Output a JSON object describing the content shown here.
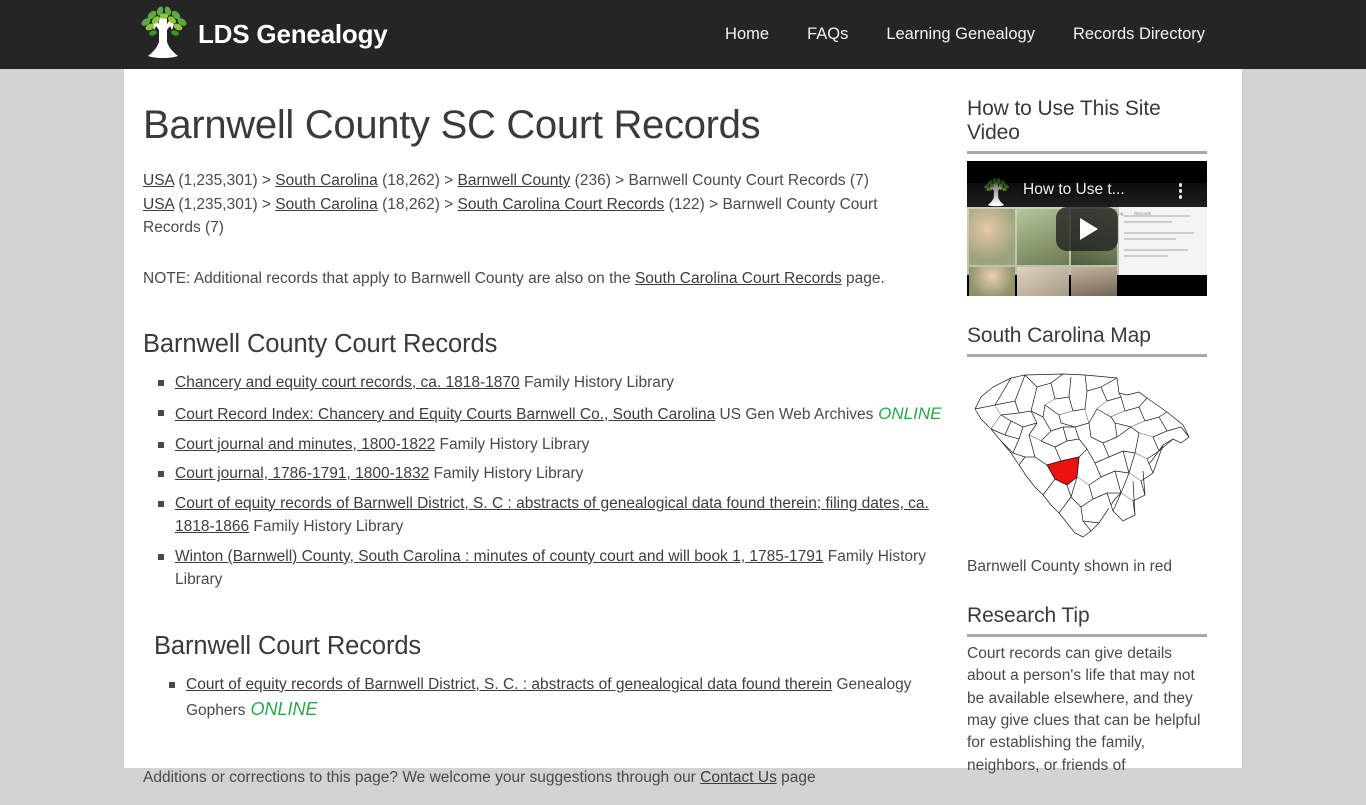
{
  "header": {
    "brand_name": "LDS Genealogy",
    "brand_logo_icon": "tree-logo-icon",
    "nav": [
      {
        "label": "Home"
      },
      {
        "label": "FAQs"
      },
      {
        "label": "Learning Genealogy"
      },
      {
        "label": "Records Directory"
      }
    ],
    "background_color": "#252525"
  },
  "main": {
    "page_title": "Barnwell County SC Court Records",
    "breadcrumbs": [
      {
        "parts": [
          {
            "text": "USA",
            "link": true
          },
          {
            "text": " (1,235,301) > ",
            "link": false
          },
          {
            "text": "South Carolina",
            "link": true
          },
          {
            "text": " (18,262) > ",
            "link": false
          },
          {
            "text": "Barnwell County",
            "link": true
          },
          {
            "text": " (236) > Barnwell County Court Records (7)",
            "link": false
          }
        ]
      },
      {
        "parts": [
          {
            "text": "USA",
            "link": true
          },
          {
            "text": " (1,235,301) > ",
            "link": false
          },
          {
            "text": "South Carolina",
            "link": true
          },
          {
            "text": " (18,262) > ",
            "link": false
          },
          {
            "text": "South Carolina Court Records",
            "link": true
          },
          {
            "text": " (122) > Barnwell County Court Records (7)",
            "link": false
          }
        ]
      }
    ],
    "note": {
      "before": "NOTE: Additional records that apply to Barnwell County are also on the ",
      "link": "South Carolina Court Records",
      "after": " page."
    },
    "sections": [
      {
        "title": "Barnwell County Court Records",
        "indent": false,
        "items": [
          {
            "link": "Chancery and equity court records, ca. 1818-1870",
            "source": "Family History Library",
            "online": ""
          },
          {
            "link": "Court Record Index: Chancery and Equity Courts Barnwell Co., South Carolina",
            "source": "US Gen Web Archives",
            "online": "ONLINE"
          },
          {
            "link": "Court journal and minutes, 1800-1822",
            "source": "Family History Library",
            "online": ""
          },
          {
            "link": "Court journal, 1786-1791, 1800-1832",
            "source": "Family History Library",
            "online": ""
          },
          {
            "link": "Court of equity records of Barnwell District, S. C : abstracts of genealogical data found therein; filing dates, ca. 1818-1866",
            "source": "Family History Library",
            "online": ""
          },
          {
            "link": "Winton (Barnwell) County, South Carolina : minutes of county court and will book 1, 1785-1791",
            "source": "Family History Library",
            "online": ""
          }
        ]
      },
      {
        "title": "Barnwell Court Records",
        "indent": true,
        "items": [
          {
            "link": "Court of equity records of Barnwell District, S. C. : abstracts of genealogical data found therein",
            "source": "Genealogy Gophers",
            "online": "ONLINE"
          }
        ]
      }
    ],
    "footer_note": {
      "before": "Additions or corrections to this page? We welcome your suggestions through our ",
      "link": "Contact Us",
      "after": " page"
    },
    "online_color": "#2aa84a"
  },
  "sidebar": {
    "video_section": {
      "heading": "How to Use This Site Video",
      "video_title_overlay": "How to Use t...",
      "play_icon": "play-button-icon",
      "menu_icon": "kebab-menu-icon",
      "logo_icon": "tree-logo-icon"
    },
    "map_section": {
      "heading": "South Carolina Map",
      "caption": "Barnwell County shown in red",
      "highlight_color": "#ee1111"
    },
    "tip_section": {
      "heading": "Research Tip",
      "text": "Court records can give details about a person's life that may not be available elsewhere, and they may give clues that can be helpful for establishing the family, neighbors, or friends of"
    }
  }
}
